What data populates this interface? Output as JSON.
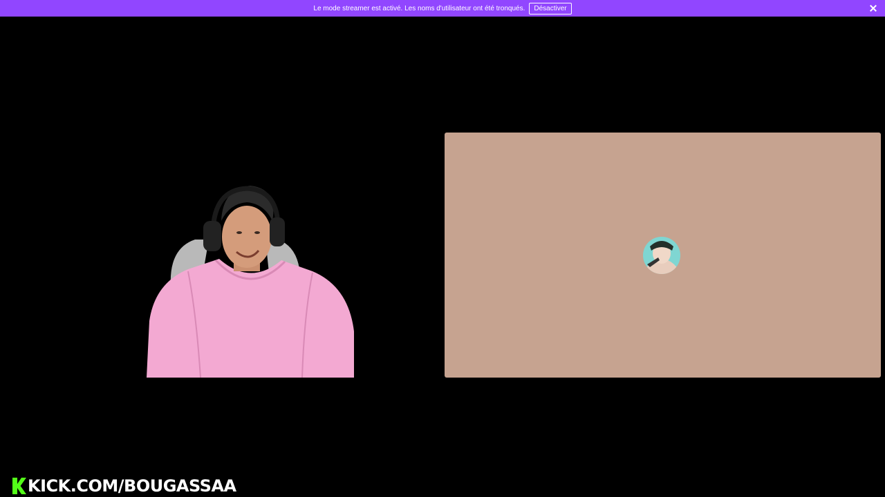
{
  "banner": {
    "message": "Le mode streamer est activé. Les noms d'utilisateur ont été tronqués.",
    "deactivate_label": "Désactiver"
  },
  "watermark": {
    "text": "KICK.COM/BOUGASSAA"
  },
  "colors": {
    "banner": "#9146ff",
    "panel": "#c6a390",
    "kick_green": "#53fc18"
  }
}
